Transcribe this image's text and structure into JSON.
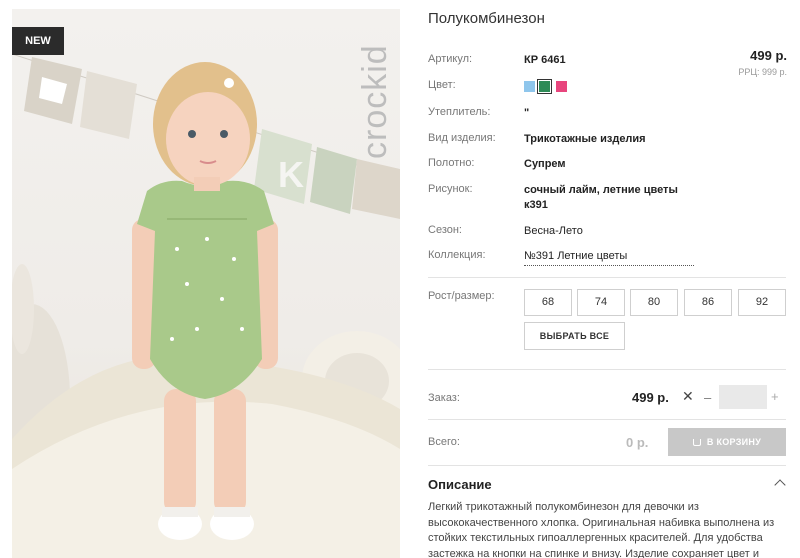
{
  "product": {
    "badge": "NEW",
    "brand_logo": "crockid",
    "title": "Полукомбинезон",
    "price": "499 р.",
    "rrp": "РРЦ: 999 р."
  },
  "specs": {
    "article_label": "Артикул:",
    "article_value": "КР 6461",
    "color_label": "Цвет:",
    "insulation_label": "Утеплитель:",
    "insulation_value": "\"",
    "type_label": "Вид изделия:",
    "type_value": "Трикотажные изделия",
    "fabric_label": "Полотно:",
    "fabric_value": "Супрем",
    "pattern_label": "Рисунок:",
    "pattern_value": "сочный лайм, летние цветы к391",
    "season_label": "Сезон:",
    "season_value": "Весна-Лето",
    "collection_label": "Коллекция:",
    "collection_value": "№391 Летние цветы"
  },
  "colors": [
    {
      "name": "light-blue",
      "hex": "#8fc6ec",
      "selected": false
    },
    {
      "name": "green",
      "hex": "#2e8b57",
      "selected": true
    },
    {
      "name": "pink",
      "hex": "#e8457d",
      "selected": false
    }
  ],
  "sizes": {
    "label": "Рост/размер:",
    "options": [
      "68",
      "74",
      "80",
      "86",
      "92"
    ],
    "select_all": "ВЫБРАТЬ ВСЕ"
  },
  "order": {
    "label": "Заказ:",
    "price": "499 р.",
    "times": "✕",
    "minus": "–",
    "plus": "+",
    "quantity": ""
  },
  "total": {
    "label": "Всего:",
    "value": "0 р.",
    "cart_button": "В КОРЗИНУ"
  },
  "description": {
    "title": "Описание",
    "text": "Легкий трикотажный полукомбинезон для девочки из высококачественного хлопка. Оригинальная набивка выполнена из стойких текстильных гипоаллергенных красителей. Для удобства застежка на кнопки на спинке и внизу. Изделие сохраняет цвет и"
  }
}
